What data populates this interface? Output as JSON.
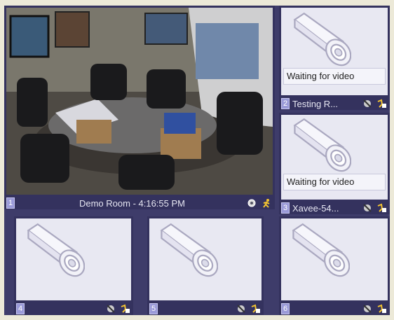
{
  "tiles": [
    {
      "number": "1",
      "label": "Demo Room - 4:16:55 PM",
      "status": ""
    },
    {
      "number": "2",
      "label": "Testing R...",
      "status": "Waiting for video"
    },
    {
      "number": "3",
      "label": "Xavee-54...",
      "status": "Waiting for video"
    },
    {
      "number": "4",
      "label": "",
      "status": ""
    },
    {
      "number": "5",
      "label": "",
      "status": ""
    },
    {
      "number": "6",
      "label": "",
      "status": ""
    }
  ],
  "icons": {
    "live": [
      "search-icon",
      "motion-detect-icon"
    ],
    "idle": [
      "no-motion-icon",
      "record-icon"
    ]
  },
  "colors": {
    "grid_bg": "#3e3c6a",
    "number_badge": "#9a9ad8",
    "empty_feed": "#e8e8f2"
  }
}
